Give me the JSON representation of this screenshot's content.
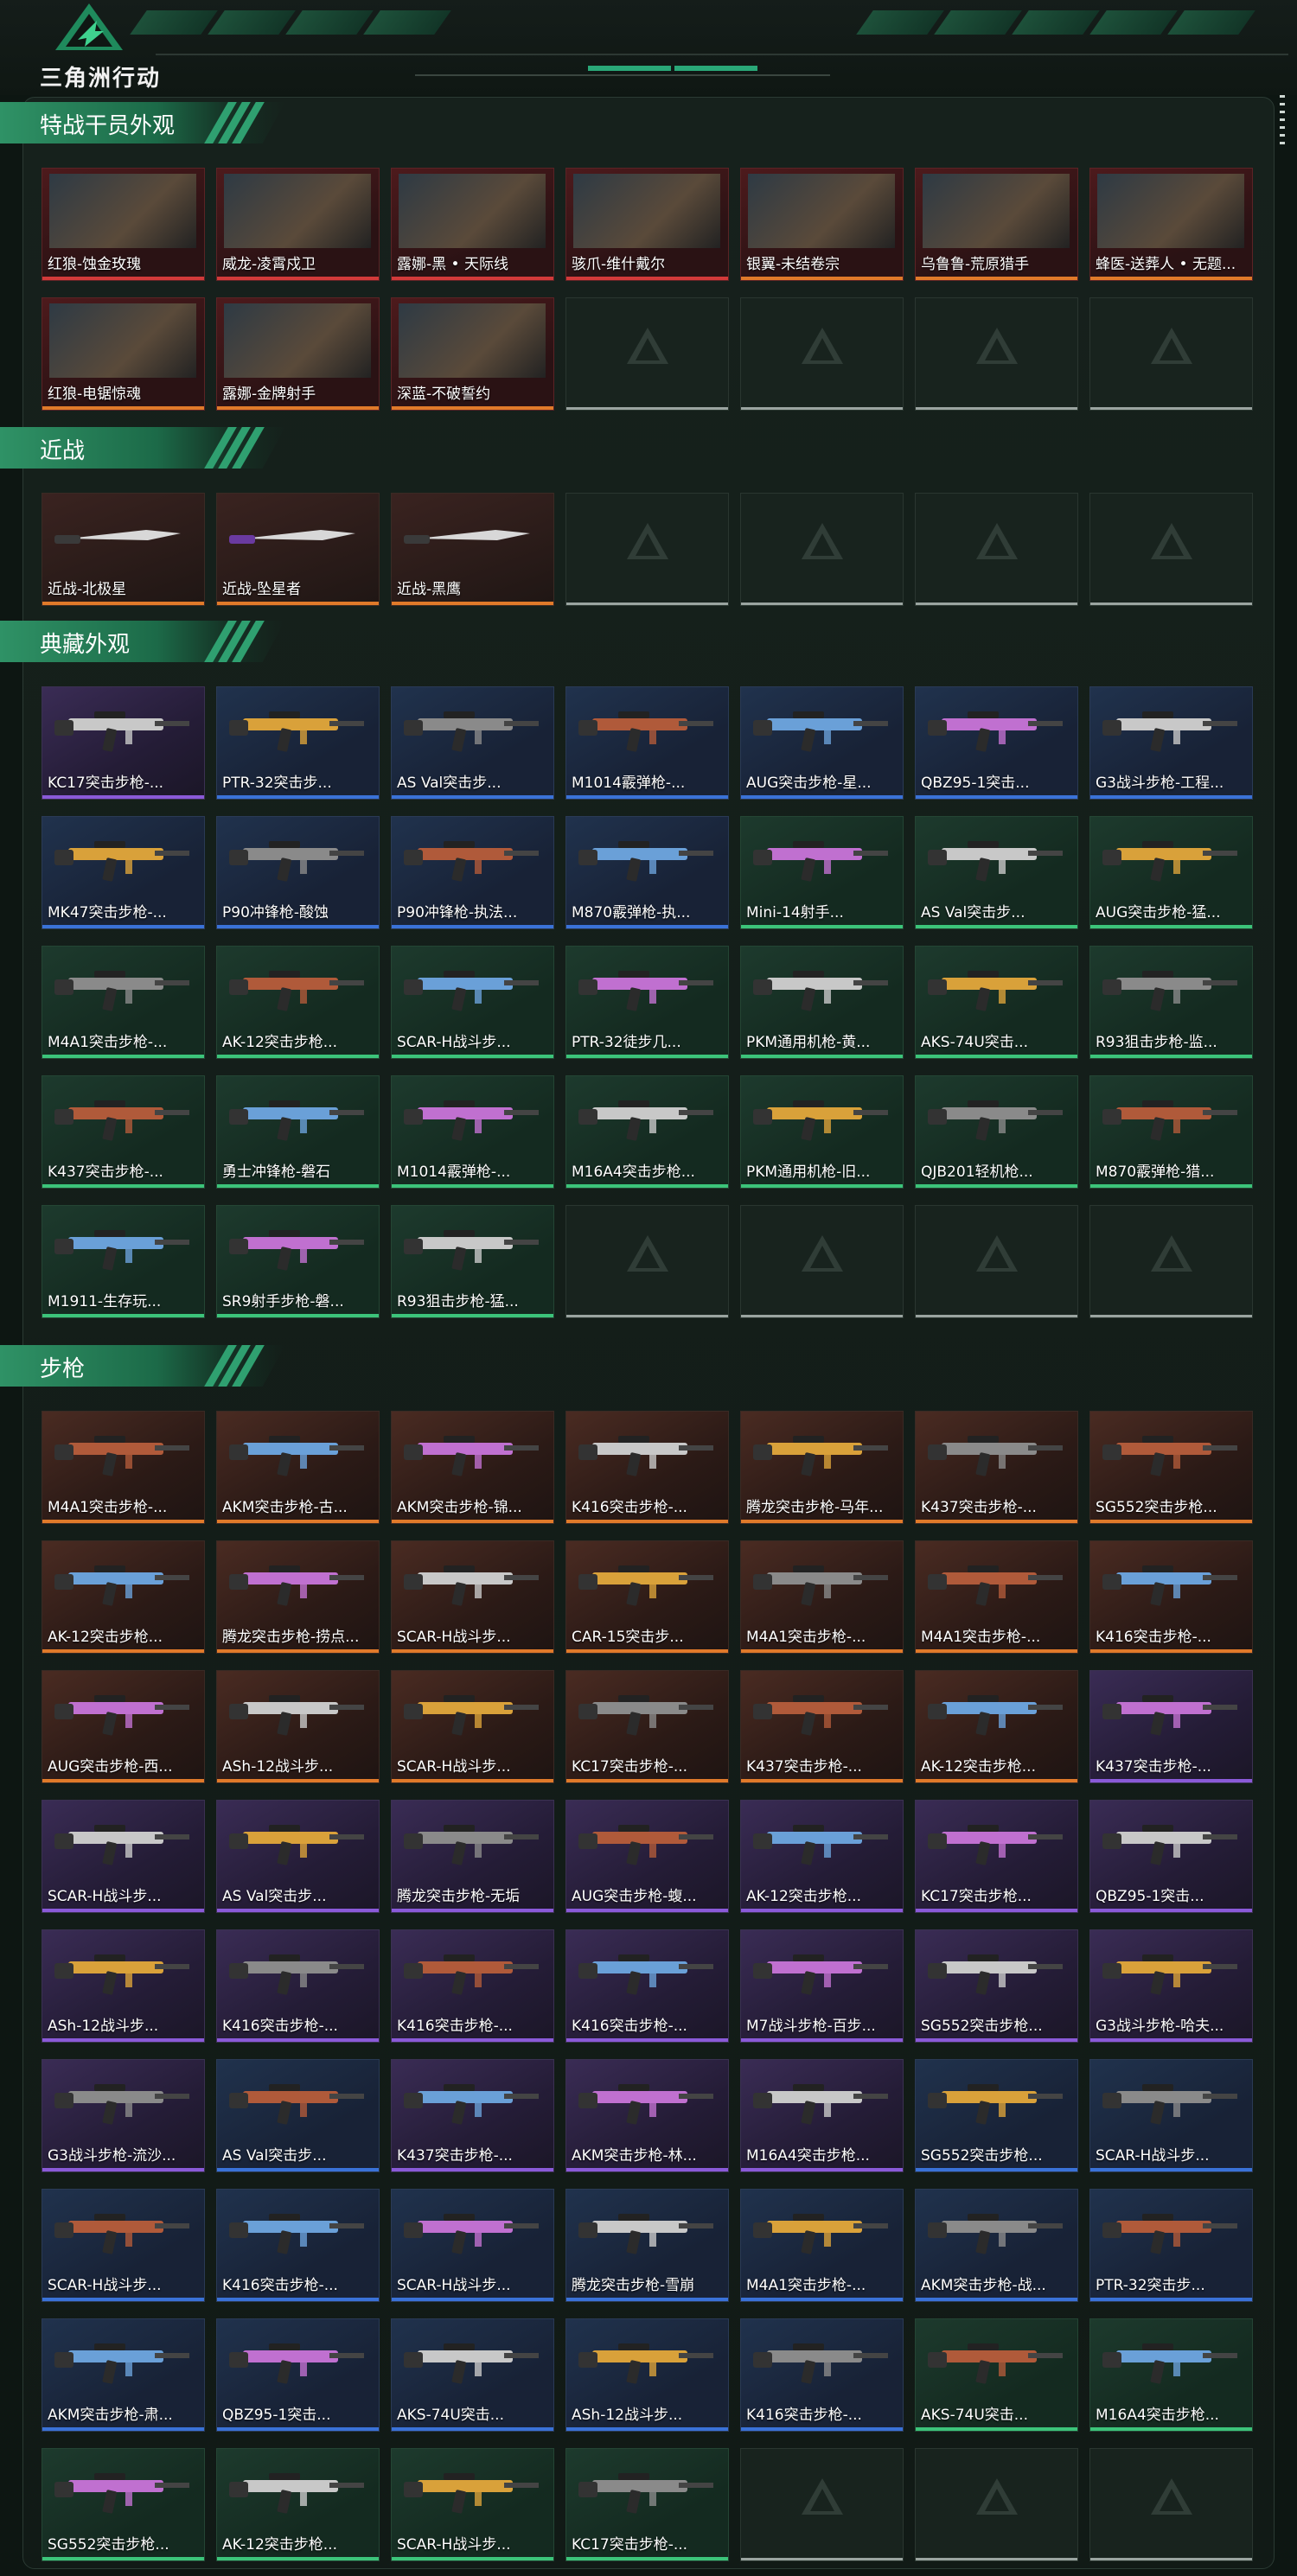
{
  "header": {
    "brand": "三角洲行动"
  },
  "sections": [
    {
      "title": "特战干员外观",
      "kind": "agent",
      "items": [
        "红狼-蚀金玫瑰",
        "威龙-凌霄戍卫",
        "露娜-黑 • 天际线",
        "骇爪-维什戴尔",
        "银翼-未结卷宗",
        "乌鲁鲁-荒原猎手",
        "蜂医-送葬人 • 无题...",
        "红狼-电锯惊魂",
        "露娜-金牌射手",
        "深蓝-不破誓约"
      ],
      "bars": [
        "red",
        "red",
        "red",
        "red",
        "orange",
        "orange",
        "orange",
        "orange",
        "orange",
        "orange"
      ],
      "slots": 14
    },
    {
      "title": "近战",
      "kind": "melee",
      "items": [
        "近战-北极星",
        "近战-坠星者",
        "近战-黑鹰"
      ],
      "bars": [
        "orange",
        "orange",
        "orange"
      ],
      "slots": 7
    },
    {
      "title": "典藏外观",
      "kind": "weapon",
      "items": [
        "KC17突击步枪-...",
        "PTR-32突击步...",
        "AS Val突击步...",
        "M1014霰弹枪-...",
        "AUG突击步枪-星...",
        "QBZ95-1突击...",
        "G3战斗步枪-工程...",
        "MK47突击步枪-...",
        "P90冲锋枪-酸蚀",
        "P90冲锋枪-执法...",
        "M870霰弹枪-执...",
        "Mini-14射手...",
        "AS Val突击步...",
        "AUG突击步枪-猛...",
        "M4A1突击步枪-...",
        "AK-12突击步枪...",
        "SCAR-H战斗步...",
        "PTR-32徒步几...",
        "PKM通用机枪-黄...",
        "AKS-74U突击...",
        "R93狙击步枪-监...",
        "K437突击步枪-...",
        "勇士冲锋枪-磐石",
        "M1014霰弹枪-...",
        "M16A4突击步枪...",
        "PKM通用机枪-旧...",
        "QJB201轻机枪...",
        "M870霰弹枪-猎...",
        "M1911-生存玩...",
        "SR9射手步枪-磐...",
        "R93狙击步枪-猛..."
      ],
      "bars": [
        "purple",
        "blue",
        "blue",
        "blue",
        "blue",
        "blue",
        "blue",
        "blue",
        "blue",
        "blue",
        "blue",
        "green",
        "green",
        "green",
        "green",
        "green",
        "green",
        "green",
        "green",
        "green",
        "green",
        "green",
        "green",
        "green",
        "green",
        "green",
        "green",
        "green",
        "green",
        "green",
        "green"
      ],
      "slots": 35
    },
    {
      "title": "步枪",
      "kind": "weapon",
      "items": [
        "M4A1突击步枪-...",
        "AKM突击步枪-古...",
        "AKM突击步枪-锦...",
        "K416突击步枪-...",
        "腾龙突击步枪-马年...",
        "K437突击步枪-...",
        "SG552突击步枪...",
        "AK-12突击步枪...",
        "腾龙突击步枪-捞点...",
        "SCAR-H战斗步...",
        "CAR-15突击步...",
        "M4A1突击步枪-...",
        "M4A1突击步枪-...",
        "K416突击步枪-...",
        "AUG突击步枪-西...",
        "ASh-12战斗步...",
        "SCAR-H战斗步...",
        "KC17突击步枪-...",
        "K437突击步枪-...",
        "AK-12突击步枪...",
        "K437突击步枪-...",
        "SCAR-H战斗步...",
        "AS Val突击步...",
        "腾龙突击步枪-无垢",
        "AUG突击步枪-蝮...",
        "AK-12突击步枪...",
        "KC17突击步枪...",
        "QBZ95-1突击...",
        "ASh-12战斗步...",
        "K416突击步枪-...",
        "K416突击步枪-...",
        "K416突击步枪-...",
        "M7战斗步枪-百步...",
        "SG552突击步枪...",
        "G3战斗步枪-哈夫...",
        "G3战斗步枪-流沙...",
        "AS Val突击步...",
        "K437突击步枪-...",
        "AKM突击步枪-林...",
        "M16A4突击步枪...",
        "SG552突击步枪...",
        "SCAR-H战斗步...",
        "SCAR-H战斗步...",
        "K416突击步枪-...",
        "SCAR-H战斗步...",
        "腾龙突击步枪-雪崩",
        "M4A1突击步枪-...",
        "AKM突击步枪-战...",
        "PTR-32突击步...",
        "AKM突击步枪-肃...",
        "QBZ95-1突击...",
        "AKS-74U突击...",
        "ASh-12战斗步...",
        "K416突击步枪-...",
        "AKS-74U突击...",
        "M16A4突击步枪...",
        "SG552突击步枪...",
        "AK-12突击步枪...",
        "SCAR-H战斗步...",
        "KC17突击步枪-..."
      ],
      "bars": [
        "orange",
        "orange",
        "orange",
        "orange",
        "orange",
        "orange",
        "orange",
        "orange",
        "orange",
        "orange",
        "orange",
        "orange",
        "orange",
        "orange",
        "orange",
        "orange",
        "orange",
        "orange",
        "orange",
        "orange",
        "purple",
        "purple",
        "purple",
        "purple",
        "purple",
        "purple",
        "purple",
        "purple",
        "purple",
        "purple",
        "purple",
        "purple",
        "purple",
        "purple",
        "purple",
        "purple",
        "blue",
        "purple",
        "purple",
        "purple",
        "blue",
        "blue",
        "blue",
        "blue",
        "blue",
        "blue",
        "blue",
        "blue",
        "blue",
        "blue",
        "blue",
        "blue",
        "blue",
        "blue",
        "green",
        "green",
        "green",
        "green",
        "green",
        "green"
      ],
      "slots": 63
    }
  ],
  "colors": {
    "red": "#d23a3a",
    "orange": "#e07a2a",
    "purple": "#8a5ad8",
    "blue": "#3a72d8",
    "green": "#3cc47a",
    "accent": "#2fa070"
  },
  "icons": {
    "logo": "delta-triangle-logo",
    "empty_slot": "delta-emblem-icon"
  }
}
